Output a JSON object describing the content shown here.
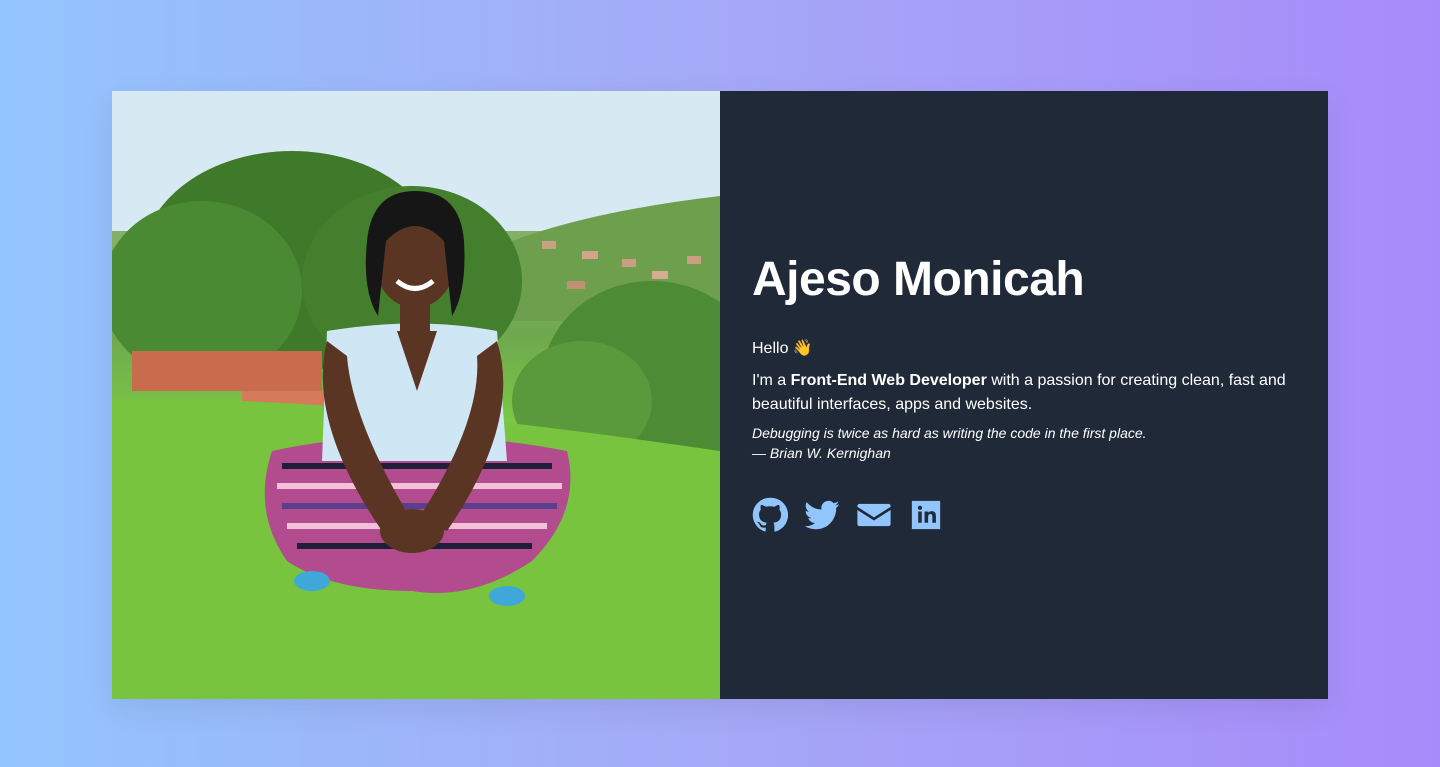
{
  "profile": {
    "name": "Ajeso Monicah",
    "greeting": "Hello",
    "greeting_emoji": "👋",
    "intro_prefix": "I'm a",
    "role": "Front-End Web Developer",
    "intro_suffix": "with a passion for creating clean, fast and beautiful interfaces, apps and websites.",
    "quote_text": "Debugging is twice as hard as writing the code in the first place.",
    "quote_author": "— Brian W. Kernighan"
  },
  "photo": {
    "icon": "portrait-photo"
  },
  "socials": [
    {
      "icon": "github-icon"
    },
    {
      "icon": "twitter-icon"
    },
    {
      "icon": "mail-icon"
    },
    {
      "icon": "linkedin-icon"
    }
  ],
  "colors": {
    "background_start": "#93c5fd",
    "background_end": "#a78bfa",
    "card_dark": "#1f2937",
    "icon_color": "#93c5fd",
    "text": "#ffffff"
  }
}
